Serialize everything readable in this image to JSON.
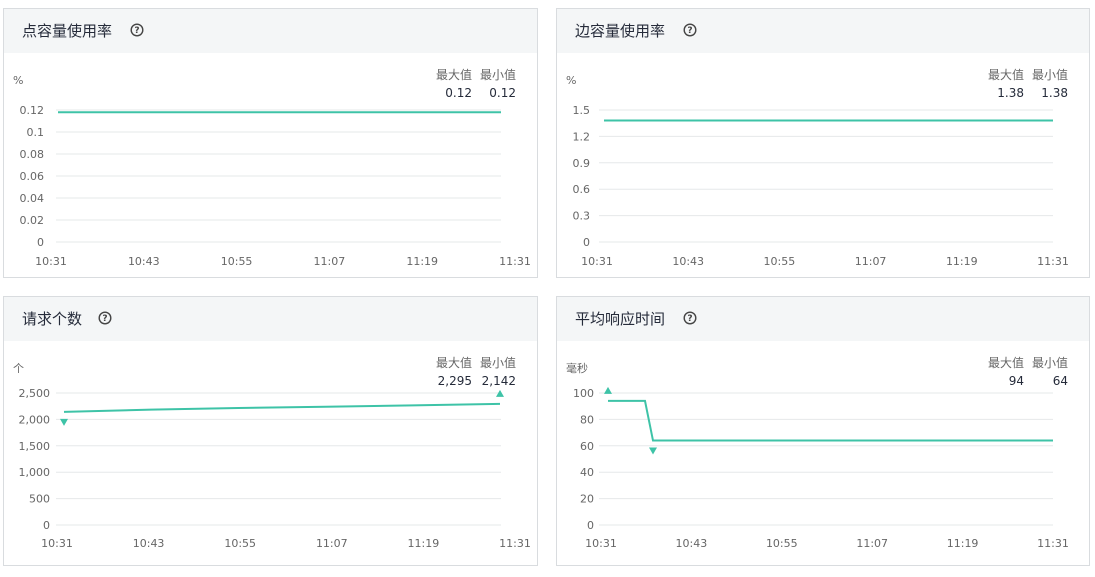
{
  "colors": {
    "line": "#3ec3a7",
    "grid": "#e6e8ea",
    "header_bg": "#f4f6f7"
  },
  "icons": {
    "help": "question-circle-icon"
  },
  "stats_labels": {
    "max": "最大值",
    "min": "最小值"
  },
  "charts": [
    {
      "title": "点容量使用率",
      "unit": "%",
      "max": "0.12",
      "min": "0.12",
      "chart_data": {
        "type": "line",
        "x": [
          "10:31",
          "10:43",
          "10:55",
          "11:07",
          "11:19",
          "11:31"
        ],
        "y_ticks": [
          "0",
          "0.02",
          "0.04",
          "0.06",
          "0.08",
          "0.1",
          "0.12"
        ],
        "ylim": [
          0,
          0.12
        ],
        "series": [
          {
            "values": [
              0.118,
              0.118,
              0.118,
              0.118,
              0.118,
              0.118
            ]
          }
        ]
      }
    },
    {
      "title": "边容量使用率",
      "unit": "%",
      "max": "1.38",
      "min": "1.38",
      "chart_data": {
        "type": "line",
        "x": [
          "10:31",
          "10:43",
          "10:55",
          "11:07",
          "11:19",
          "11:31"
        ],
        "y_ticks": [
          "0",
          "0.3",
          "0.6",
          "0.9",
          "1.2",
          "1.5"
        ],
        "ylim": [
          0,
          1.5
        ],
        "series": [
          {
            "values": [
              1.38,
              1.38,
              1.38,
              1.38,
              1.38,
              1.38
            ]
          }
        ]
      }
    },
    {
      "title": "请求个数",
      "unit": "个",
      "max": "2,295",
      "min": "2,142",
      "chart_data": {
        "type": "line",
        "x": [
          "10:31",
          "10:43",
          "10:55",
          "11:07",
          "11:19",
          "11:31"
        ],
        "y_ticks": [
          "0",
          "500",
          "1,000",
          "1,500",
          "2,000",
          "2,500"
        ],
        "ylim": [
          0,
          2500
        ],
        "series": [
          {
            "values": [
              2142,
              2185,
              2215,
              2240,
              2265,
              2295
            ]
          }
        ],
        "min_marker_index": 0,
        "max_marker_index": 5
      }
    },
    {
      "title": "平均响应时间",
      "unit": "毫秒",
      "max": "94",
      "min": "64",
      "chart_data": {
        "type": "line",
        "x": [
          "10:31",
          "10:43",
          "10:55",
          "11:07",
          "11:19",
          "11:31"
        ],
        "y_ticks": [
          "0",
          "20",
          "40",
          "60",
          "80",
          "100"
        ],
        "ylim": [
          0,
          100
        ],
        "series": [
          {
            "values": [
              94,
              94,
              64,
              64,
              64,
              64,
              64
            ]
          }
        ],
        "min_marker_index": 2,
        "max_marker_index": 0
      }
    }
  ]
}
